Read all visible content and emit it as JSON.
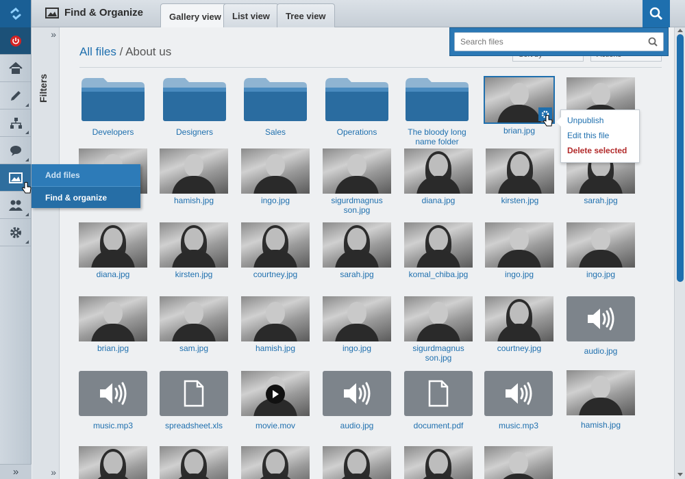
{
  "app": {
    "title": "Find & Organize",
    "accent": "#1e6fae"
  },
  "tabs": [
    {
      "label": "Gallery view",
      "active": true
    },
    {
      "label": "List view",
      "active": false
    },
    {
      "label": "Tree view",
      "active": false
    }
  ],
  "search": {
    "placeholder": "Search files"
  },
  "filters": {
    "label": "Filters"
  },
  "breadcrumb": {
    "root": "All files",
    "separator": " / ",
    "current": "About us"
  },
  "hidden_controls": {
    "sort": "Sort by",
    "actions": "Actions"
  },
  "rail": [
    "logo-icon",
    "power-icon",
    "home-icon",
    "pencil-icon",
    "sitemap-icon",
    "chat-icon",
    "image-icon",
    "people-icon",
    "gear-icon"
  ],
  "flyout": {
    "items": [
      "Add files",
      "Find & organize"
    ]
  },
  "context_menu": {
    "items": [
      "Unpublish",
      "Edit this file",
      "Delete selected"
    ]
  },
  "folders": [
    "Developers",
    "Designers",
    "Sales",
    "Operations",
    "The bloody long name folder"
  ],
  "row1_files": [
    "brian.jpg"
  ],
  "row2_files": [
    "hamish.jpg",
    "ingo.jpg",
    "sigurdmagnus son.jpg",
    "diana.jpg",
    "kirsten.jpg",
    "sarah.jpg"
  ],
  "row3_files": [
    "diana.jpg",
    "kirsten.jpg",
    "courtney.jpg",
    "sarah.jpg",
    "komal_chiba.jpg",
    "ingo.jpg",
    "ingo.jpg"
  ],
  "row4_files": [
    "brian.jpg",
    "sam.jpg",
    "hamish.jpg",
    "ingo.jpg",
    "sigurdmagnus son.jpg",
    "courtney.jpg",
    "audio.jpg"
  ],
  "row5_files": [
    "music.mp3",
    "spreadsheet.xls",
    "movie.mov",
    "audio.jpg",
    "document.pdf",
    "music.mp3",
    "hamish.jpg"
  ]
}
